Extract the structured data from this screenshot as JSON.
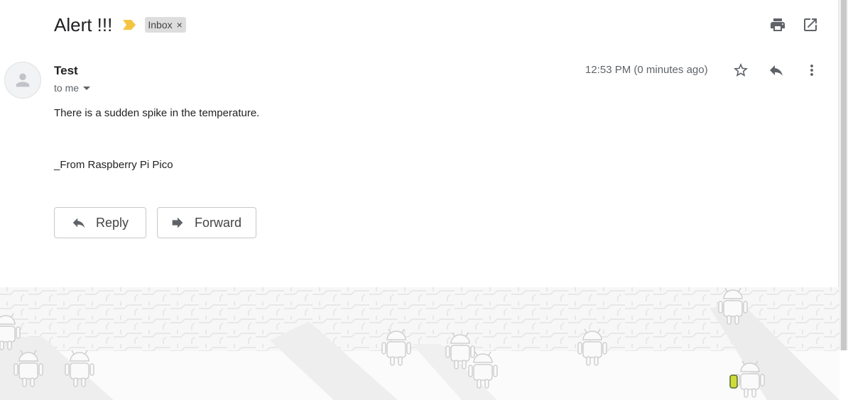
{
  "message": {
    "subject": "Alert !!!",
    "label": "Inbox",
    "label_remove": "×",
    "sender": "Test",
    "recipients": "to me",
    "timestamp": "12:53 PM (0 minutes ago)",
    "body_line1": "There is a sudden spike in the temperature.",
    "body_line2": "_From Raspberry Pi Pico"
  },
  "buttons": {
    "reply_label": "Reply",
    "forward_label": "Forward"
  },
  "icons": {
    "importance": "importance-marker-icon",
    "print": "print-icon",
    "open_new_window": "open-in-new-window-icon",
    "star": "star-icon",
    "reply": "reply-icon",
    "more": "more-vert-icon",
    "avatar": "person-icon"
  },
  "colors": {
    "importance": "#f4c542",
    "chip_bg": "#dddddd",
    "icon": "#5f6368"
  }
}
